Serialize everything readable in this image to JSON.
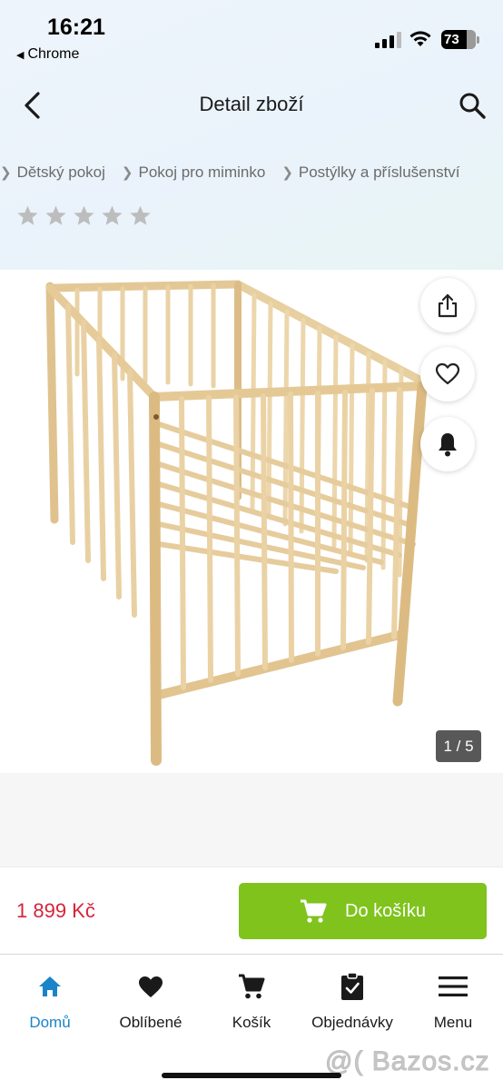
{
  "status": {
    "time": "16:21",
    "back_app": "Chrome",
    "battery": "73"
  },
  "header": {
    "title": "Detail zboží"
  },
  "breadcrumb": [
    "Dětský pokoj",
    "Pokoj pro miminko",
    "Postýlky a příslušenství"
  ],
  "rating": {
    "stars_filled": 0,
    "stars_total": 5
  },
  "gallery": {
    "counter": "1 / 5"
  },
  "purchase": {
    "price": "1 899 Kč",
    "cart_button": "Do košíku",
    "price_color": "#d6243a",
    "button_color": "#7fc31c"
  },
  "nav": {
    "items": [
      {
        "label": "Domů",
        "icon": "home-icon",
        "active": true
      },
      {
        "label": "Oblíbené",
        "icon": "heart-icon",
        "active": false
      },
      {
        "label": "Košík",
        "icon": "cart-icon",
        "active": false
      },
      {
        "label": "Objednávky",
        "icon": "clipboard-icon",
        "active": false
      },
      {
        "label": "Menu",
        "icon": "hamburger-icon",
        "active": false
      }
    ],
    "active_color": "#1b84c9"
  },
  "watermark": "@( Bazos.cz"
}
